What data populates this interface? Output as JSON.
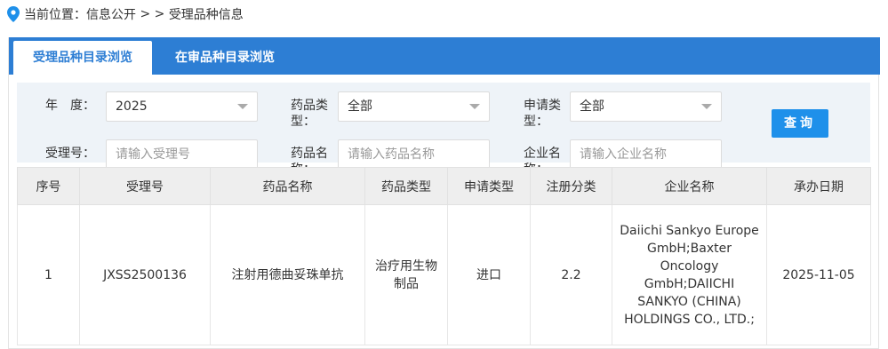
{
  "breadcrumb": {
    "prefix": "当前位置：",
    "items": [
      "信息公开",
      "受理品种信息"
    ],
    "separator": " > > "
  },
  "tabs": [
    {
      "label": "受理品种目录浏览",
      "active": true
    },
    {
      "label": "在审品种目录浏览",
      "active": false
    }
  ],
  "filters": {
    "year_label": "年　度：",
    "year_value": "2025",
    "drug_type_label": "药品类型：",
    "drug_type_value": "全部",
    "apply_type_label": "申请类型：",
    "apply_type_value": "全部",
    "accept_no_label": "受理号：",
    "accept_no_placeholder": "请输入受理号",
    "drug_name_label": "药品名称：",
    "drug_name_placeholder": "请输入药品名称",
    "company_label": "企业名称：",
    "company_placeholder": "请输入企业名称",
    "query_button": "查询"
  },
  "table": {
    "headers": [
      "序号",
      "受理号",
      "药品名称",
      "药品类型",
      "申请类型",
      "注册分类",
      "企业名称",
      "承办日期"
    ],
    "rows": [
      [
        "1",
        "JXSS2500136",
        "注射用德曲妥珠单抗",
        "治疗用生物制品",
        "进口",
        "2.2",
        "Daiichi Sankyo Europe GmbH;Baxter Oncology GmbH;DAIICHI SANKYO (CHINA) HOLDINGS CO., LTD.;",
        "2025-11-05"
      ]
    ]
  },
  "colors": {
    "accent": "#2d7ed4",
    "button": "#1e90ea",
    "filter_bg": "#eef3f8",
    "header_bg": "#eeeeee"
  }
}
